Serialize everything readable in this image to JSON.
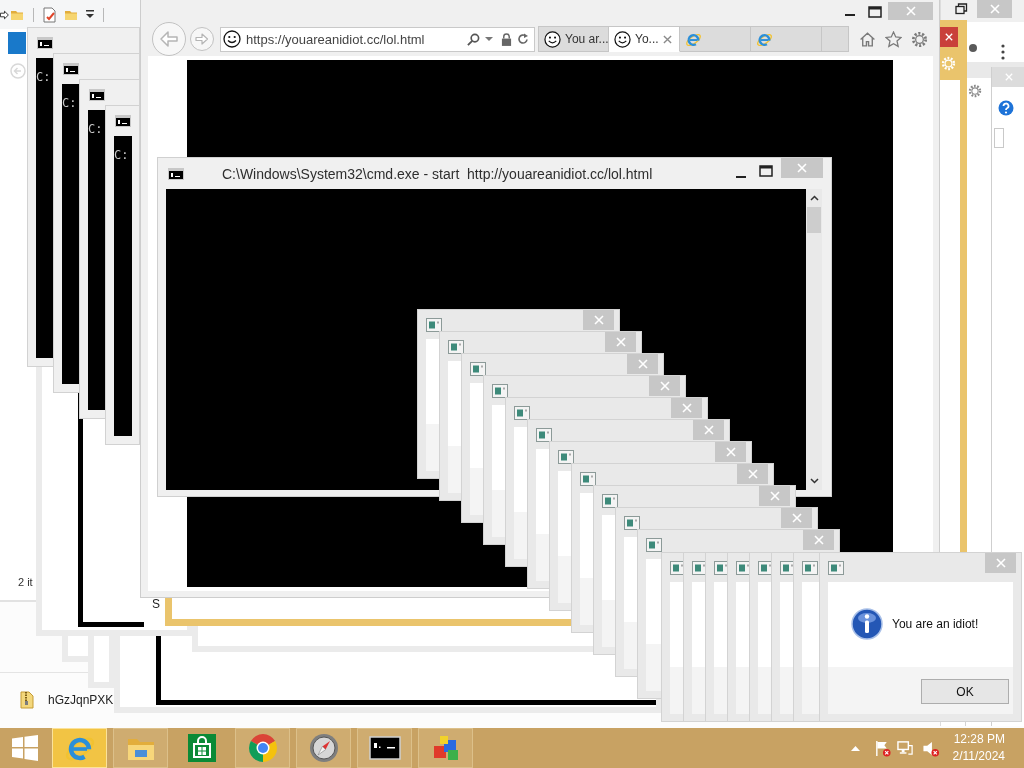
{
  "explorer_window": {
    "status": "2 it"
  },
  "file_window": {
    "file_name": "hGzJqnPXK"
  },
  "popup_window": {
    "text": "S"
  },
  "console_windows": [
    {
      "prompt": "C:"
    },
    {
      "prompt": "C:"
    },
    {
      "prompt": "C:"
    },
    {
      "prompt": "C:"
    }
  ],
  "browser": {
    "address": "https://youareanidiot.cc/lol.html",
    "tabs": [
      {
        "kind": "page",
        "label": "You ar...",
        "selected": false
      },
      {
        "kind": "page",
        "label": "Yo...",
        "selected": true
      },
      {
        "kind": "ie",
        "selected": false
      },
      {
        "kind": "ie",
        "selected": false
      },
      {
        "kind": "new",
        "selected": false
      }
    ]
  },
  "cmd_window": {
    "title": "C:\\Windows\\System32\\cmd.exe - start  http://youareanidiot.cc/lol.html"
  },
  "message_box": {
    "message": "You are an idiot!",
    "button": "OK"
  },
  "taskbar": {
    "apps": [
      {
        "kind": "ie",
        "running": true,
        "active": true
      },
      {
        "kind": "explorer",
        "running": true,
        "active": false
      },
      {
        "kind": "store",
        "running": false,
        "active": false
      },
      {
        "kind": "chrome",
        "running": true,
        "active": false
      },
      {
        "kind": "compass",
        "running": true,
        "active": false
      },
      {
        "kind": "console",
        "running": true,
        "active": false
      },
      {
        "kind": "cubes",
        "running": true,
        "active": false
      }
    ],
    "time": "12:28 PM",
    "date": "2/11/2024"
  }
}
